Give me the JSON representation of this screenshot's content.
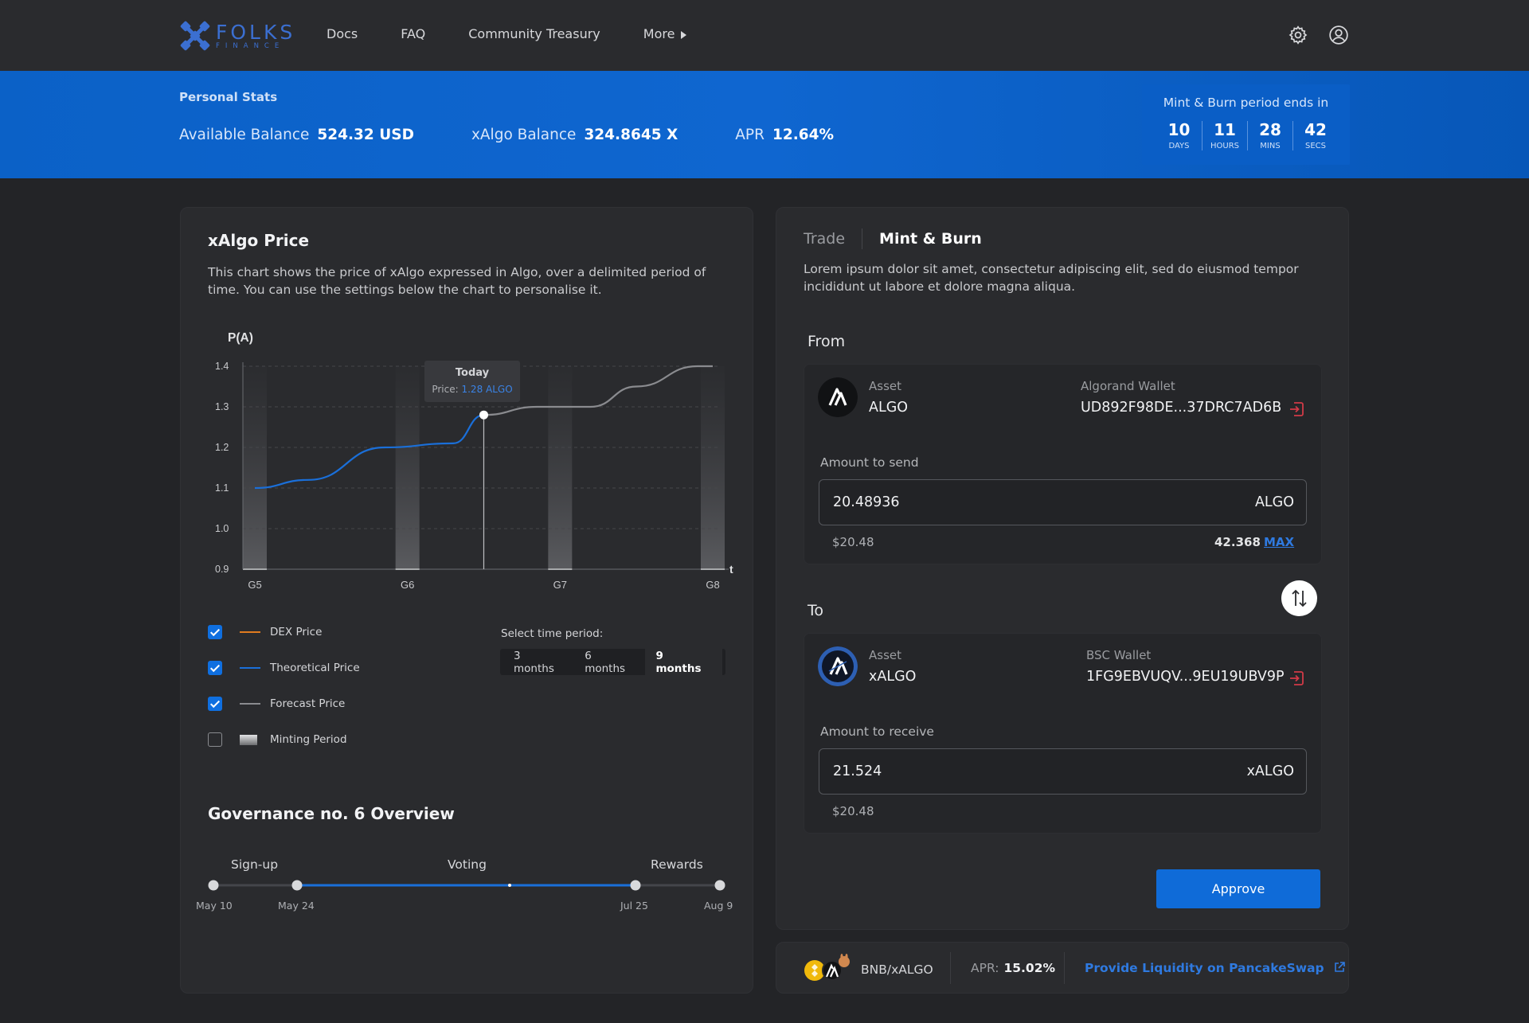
{
  "brand": {
    "name": "FOLKS",
    "sub": "FINANCE"
  },
  "nav": {
    "items": [
      "Docs",
      "FAQ",
      "Community Treasury"
    ],
    "more_label": "More"
  },
  "personal_stats": {
    "title": "Personal Stats",
    "available_balance_label": "Available Balance",
    "available_balance_value": "524.32 USD",
    "xalgo_balance_label": "xAlgo Balance",
    "xalgo_balance_value": "324.8645 X",
    "apr_label": "APR",
    "apr_value": "12.64%"
  },
  "countdown": {
    "title": "Mint & Burn period ends in",
    "units": [
      {
        "num": "10",
        "label": "DAYS"
      },
      {
        "num": "11",
        "label": "HOURS"
      },
      {
        "num": "28",
        "label": "MINS"
      },
      {
        "num": "42",
        "label": "SECS"
      }
    ]
  },
  "price_panel": {
    "title": "xAlgo Price",
    "description": "This chart shows the price of xAlgo expressed in Algo, over a delimited period of time. You can use the settings below the chart to personalise it.",
    "tooltip_title": "Today",
    "tooltip_price_label": "Price:",
    "tooltip_price_value": "1.28 ALGO"
  },
  "chart_data": {
    "type": "line",
    "ylabel": "P(A)",
    "xlabel": "t",
    "ylim": [
      0.9,
      1.4
    ],
    "yticks": [
      "1.4",
      "1.3",
      "1.2",
      "1.1",
      "1.0",
      "0.9"
    ],
    "categories": [
      "G5",
      "G6",
      "G7",
      "G8"
    ],
    "series": [
      {
        "name": "Theoretical Price",
        "color": "#1a6fd9",
        "x": [
          0,
          0.35,
          0.85,
          1.3,
          1.5
        ],
        "y": [
          1.1,
          1.12,
          1.2,
          1.21,
          1.28
        ]
      },
      {
        "name": "Forecast Price",
        "color": "#8a8b8f",
        "x": [
          1.5,
          1.85,
          2.2,
          2.5,
          2.9,
          3.0
        ],
        "y": [
          1.28,
          1.3,
          1.3,
          1.35,
          1.4,
          1.4
        ]
      }
    ],
    "minting_periods": [
      0,
      1,
      2,
      3
    ],
    "today_x": 1.5
  },
  "legend": {
    "items": [
      {
        "label": "DEX Price",
        "checked": true,
        "color": "#e07b1f",
        "kind": "line"
      },
      {
        "label": "Theoretical Price",
        "checked": true,
        "color": "#1a6fd9",
        "kind": "line"
      },
      {
        "label": "Forecast Price",
        "checked": true,
        "color": "#8a8b8f",
        "kind": "line"
      },
      {
        "label": "Minting Period",
        "checked": false,
        "color": "#cfd0d2",
        "kind": "gradient"
      }
    ]
  },
  "time_period": {
    "label": "Select time period:",
    "options": [
      "3 months",
      "6 months",
      "9 months"
    ],
    "selected": "9 months"
  },
  "governance": {
    "title": "Governance no. 6 Overview",
    "phases": [
      "Sign-up",
      "Voting",
      "Rewards"
    ],
    "dates": [
      "May 10",
      "May 24",
      "Jul 25",
      "Aug 9"
    ],
    "progress_fraction": 0.58
  },
  "swap": {
    "tabs": [
      "Trade",
      "Mint & Burn"
    ],
    "active_tab": "Mint & Burn",
    "description": "Lorem ipsum dolor sit amet, consectetur adipiscing elit, sed do eiusmod tempor incididunt ut labore et dolore magna aliqua.",
    "from": {
      "section_label": "From",
      "asset_label": "Asset",
      "asset": "ALGO",
      "wallet_label": "Algorand Wallet",
      "wallet": "UD892F98DE...37DRC7AD6B",
      "amount_label": "Amount to send",
      "amount": "20.48936",
      "unit": "ALGO",
      "usd": "$20.48",
      "balance": "42.368",
      "max_label": "MAX"
    },
    "to": {
      "section_label": "To",
      "asset_label": "Asset",
      "asset": "xALGO",
      "wallet_label": "BSC Wallet",
      "wallet": "1FG9EBVUQV...9EU19UBV9P",
      "amount_label": "Amount to receive",
      "amount": "21.524",
      "unit": "xALGO",
      "usd": "$20.48"
    },
    "approve_label": "Approve"
  },
  "liquidity": {
    "pair": "BNB/xALGO",
    "apr_label": "APR:",
    "apr_value": "15.02%",
    "link_label": "Provide Liquidity on PancakeSwap"
  },
  "colors": {
    "accent": "#0f6bd8",
    "banner": "#0b61c7",
    "background": "#232427",
    "panel": "#2a2b2e"
  }
}
